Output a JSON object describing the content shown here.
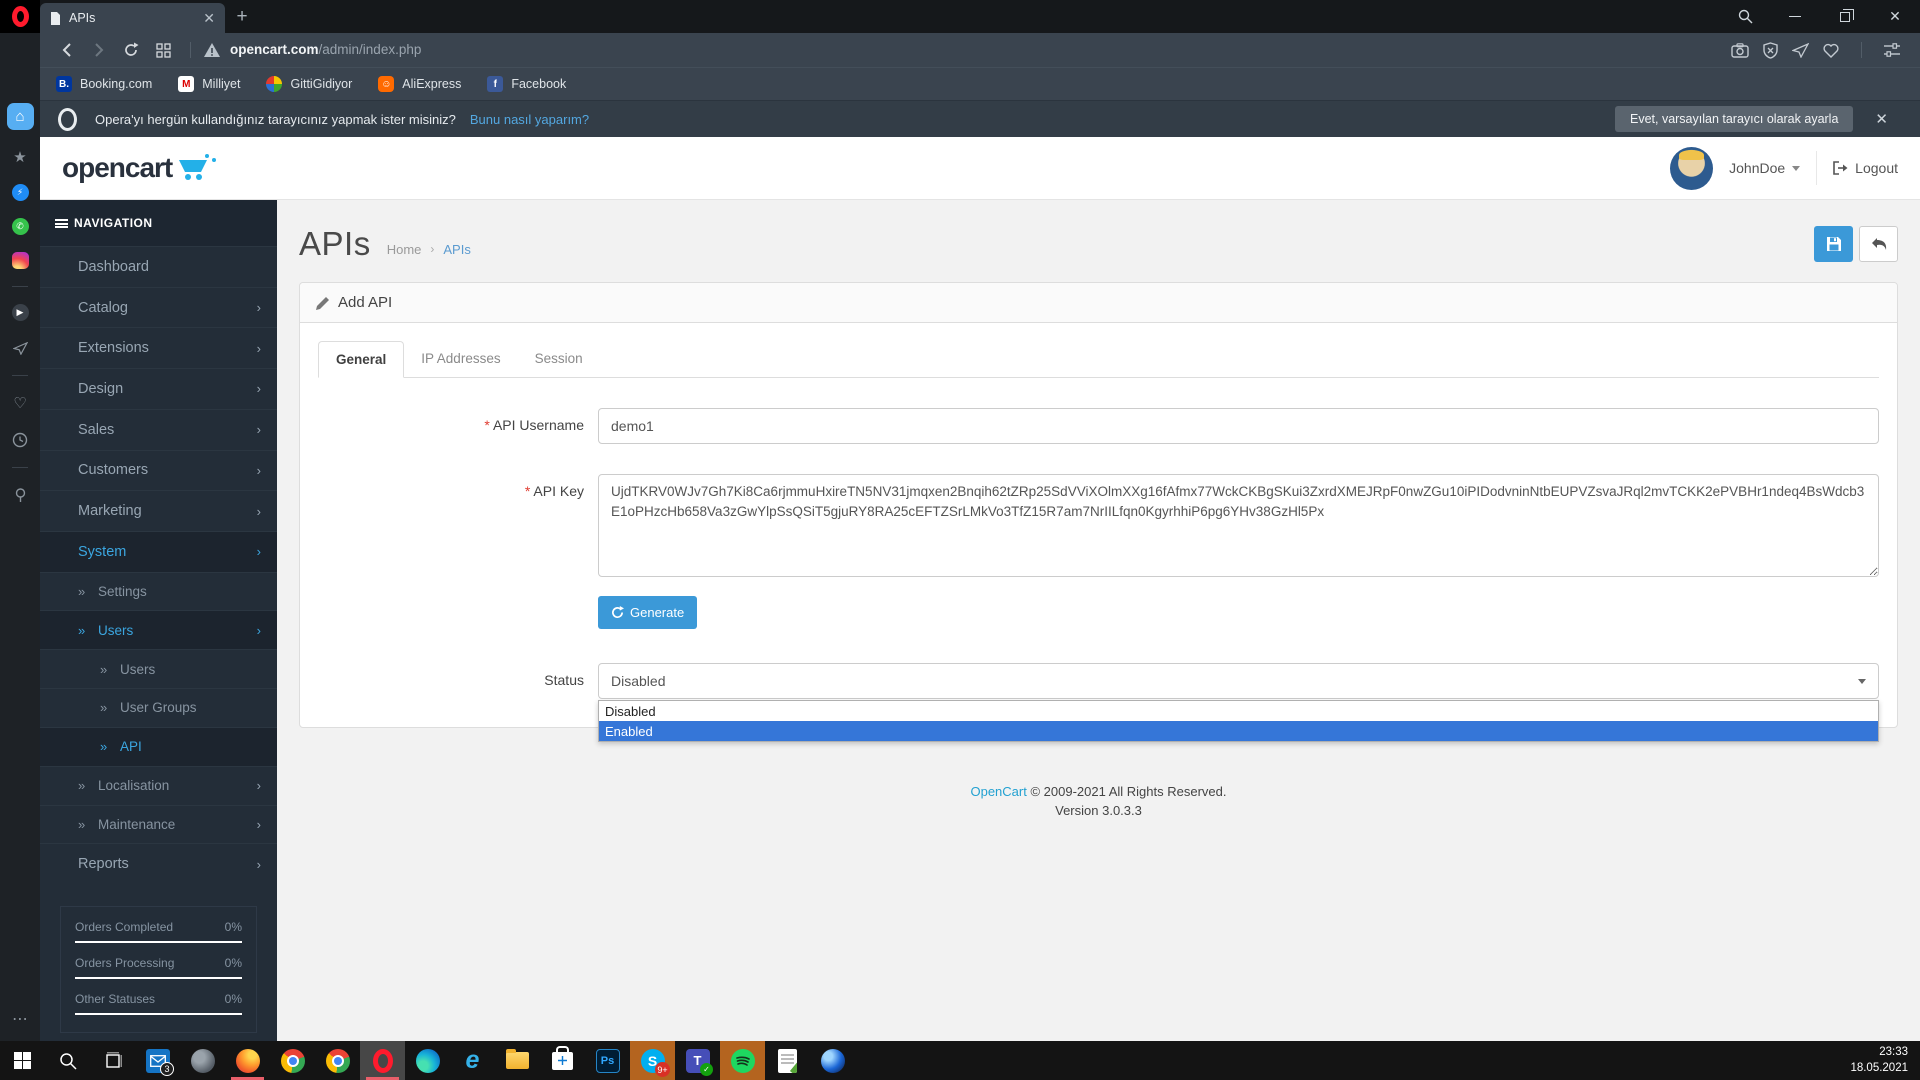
{
  "browser": {
    "tab_title": "APIs",
    "url_domain": "opencart.com",
    "url_path": "/admin/index.php",
    "bookmarks": [
      {
        "label": "Booking.com",
        "favicon_text": "B."
      },
      {
        "label": "Milliyet",
        "favicon_text": "M"
      },
      {
        "label": "GittiGidiyor",
        "favicon_text": ""
      },
      {
        "label": "AliExpress",
        "favicon_text": ""
      },
      {
        "label": "Facebook",
        "favicon_text": "f"
      }
    ],
    "notification": {
      "message": "Opera'yı hergün kullandığınız tarayıcınız yapmak ister misiniz?",
      "link_label": "Bunu nasıl yaparım?",
      "accept_button": "Evet, varsayılan tarayıcı olarak ayarla"
    }
  },
  "opencart": {
    "header": {
      "logo_text": "opencart",
      "username": "JohnDoe",
      "logout_label": "Logout"
    },
    "sidebar": {
      "nav_title": "NAVIGATION",
      "items": [
        {
          "label": "Dashboard"
        },
        {
          "label": "Catalog"
        },
        {
          "label": "Extensions"
        },
        {
          "label": "Design"
        },
        {
          "label": "Sales"
        },
        {
          "label": "Customers"
        },
        {
          "label": "Marketing"
        },
        {
          "label": "System"
        },
        {
          "label": "Settings"
        },
        {
          "label": "Users"
        },
        {
          "label": "Users"
        },
        {
          "label": "User Groups"
        },
        {
          "label": "API"
        },
        {
          "label": "Localisation"
        },
        {
          "label": "Maintenance"
        },
        {
          "label": "Reports"
        }
      ],
      "stats": [
        {
          "label": "Orders Completed",
          "value": "0%"
        },
        {
          "label": "Orders Processing",
          "value": "0%"
        },
        {
          "label": "Other Statuses",
          "value": "0%"
        }
      ]
    },
    "page": {
      "title": "APIs",
      "breadcrumb_home": "Home",
      "breadcrumb_current": "APIs"
    },
    "panel": {
      "heading": "Add API",
      "tabs": [
        {
          "label": "General"
        },
        {
          "label": "IP Addresses"
        },
        {
          "label": "Session"
        }
      ]
    },
    "form": {
      "username_label": "API Username",
      "username_value": "demo1",
      "apikey_label": "API Key",
      "apikey_value": "UjdTKRV0WJv7Gh7Ki8Ca6rjmmuHxireTN5NV31jmqxen2Bnqih62tZRp25SdVViXOlmXXg16fAfmx77WckCKBgSKui3ZxrdXMEJRpF0nwZGu10iPIDodvninNtbEUPVZsvaJRql2mvTCKK2ePVBHr1ndeq4BsWdcb3E1oPHzcHb658Va3zGwYlpSsQSiT5gjuRY8RA25cEFTZSrLMkVo3TfZ15R7am7NrIILfqn0KgyrhhiP6pg6YHv38GzHl5Px",
      "generate_label": "Generate",
      "status_label": "Status",
      "status_value": "Disabled",
      "options": [
        {
          "label": "Disabled"
        },
        {
          "label": "Enabled"
        }
      ]
    },
    "footer": {
      "copyright_link": "OpenCart",
      "copyright_rest": " © 2009-2021 All Rights Reserved.",
      "version": "Version 3.0.3.3"
    }
  },
  "taskbar": {
    "mail_badge": "3",
    "skype_badge": "9+",
    "teams_badge": "✓",
    "clock_time": "23:33",
    "clock_date": "18.05.2021"
  }
}
